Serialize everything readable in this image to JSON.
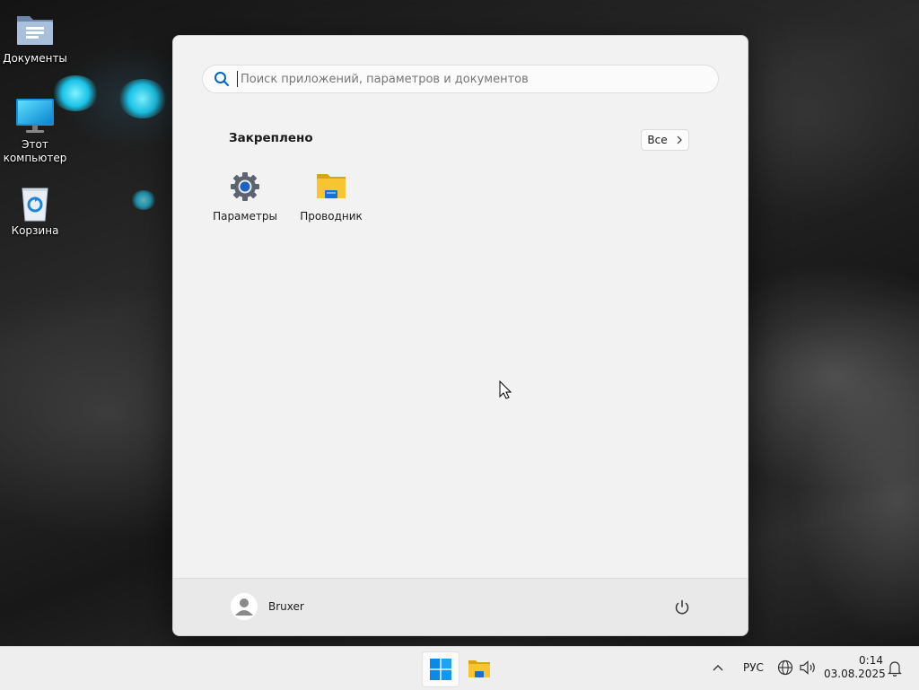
{
  "desktop": {
    "icons": [
      {
        "label": "Документы"
      },
      {
        "label": "Этот компьютер"
      },
      {
        "label": "Корзина"
      }
    ]
  },
  "start_menu": {
    "search": {
      "placeholder": "Поиск приложений, параметров и документов",
      "value": ""
    },
    "pinned_title": "Закреплено",
    "all_button": "Все",
    "pinned_apps": [
      {
        "label": "Параметры",
        "icon": "gear-icon"
      },
      {
        "label": "Проводник",
        "icon": "folder-icon"
      }
    ],
    "user": {
      "name": "Bruxer"
    }
  },
  "taskbar": {
    "language": "РУС",
    "time": "0:14",
    "date": "03.08.2025"
  },
  "colors": {
    "accent": "#0067c0",
    "folder": "#f4c430",
    "start_bg": "#f2f2f2",
    "taskbar_bg": "#eeeeee"
  }
}
